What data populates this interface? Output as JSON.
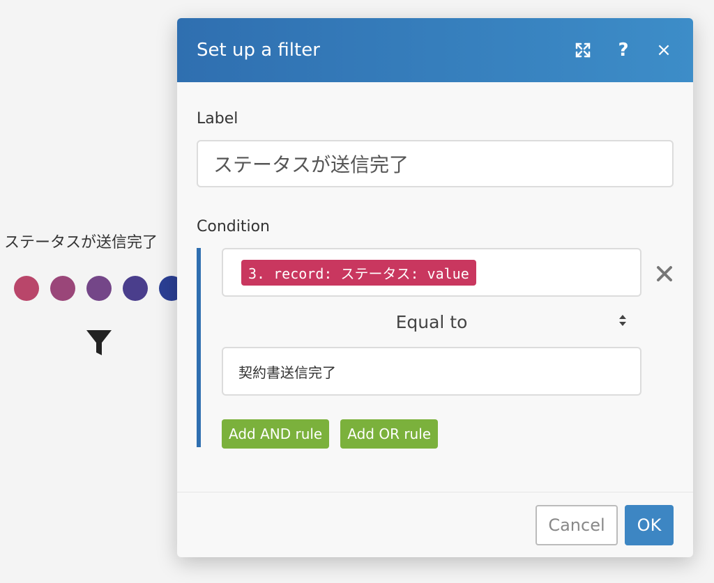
{
  "canvas": {
    "module_label": "ステータスが送信完了",
    "dot_colors": [
      "#b9466a",
      "#9a4679",
      "#744688",
      "#4a3e8c",
      "#2b3f94"
    ],
    "filter_icon": "funnel-icon"
  },
  "modal": {
    "title": "Set up a filter",
    "icons": {
      "expand": "expand-icon",
      "help": "?",
      "close": "×"
    },
    "label_field": {
      "label": "Label",
      "value": "ステータスが送信完了"
    },
    "condition": {
      "label": "Condition",
      "field_pill": "3. record: ステータス: value",
      "operator": "Equal to",
      "value": "契約書送信完了",
      "add_and_rule": "Add AND rule",
      "add_or_rule": "Add OR rule"
    },
    "footer": {
      "cancel": "Cancel",
      "ok": "OK"
    }
  },
  "colors": {
    "header_start": "#2f6fb0",
    "header_end": "#3d8dc8",
    "pill": "#c9375f",
    "green": "#7bb13c",
    "ok": "#3d86c3",
    "accent_bar": "#2f6fb0"
  }
}
